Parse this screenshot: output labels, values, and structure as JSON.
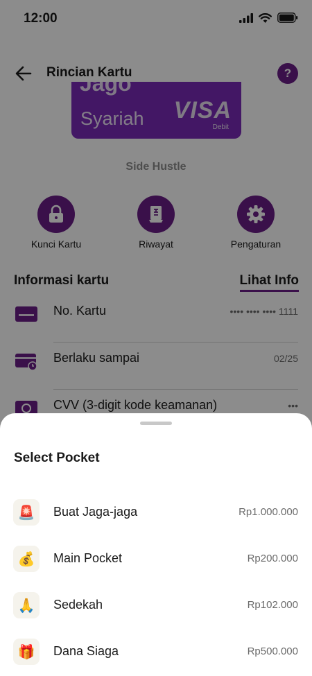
{
  "status_bar": {
    "time": "12:00"
  },
  "header": {
    "title": "Rincian Kartu",
    "help_label": "?"
  },
  "card": {
    "brand_top": "Jago",
    "brand": "Syariah",
    "network": "VISA",
    "network_sub": "Debit",
    "name": "Side Hustle"
  },
  "actions": [
    {
      "label": "Kunci Kartu",
      "icon": "lock-icon"
    },
    {
      "label": "Riwayat",
      "icon": "receipt-icon"
    },
    {
      "label": "Pengaturan",
      "icon": "gear-icon"
    }
  ],
  "info": {
    "title": "Informasi kartu",
    "link": "Lihat Info",
    "rows": [
      {
        "label": "No. Kartu",
        "value": "•••• •••• •••• 1111",
        "icon": "card-number-icon"
      },
      {
        "label": "Berlaku sampai",
        "value": "02/25",
        "icon": "card-expiry-icon"
      },
      {
        "label": "CVV (3-digit kode keamanan)",
        "value": "•••",
        "icon": "cvv-icon"
      }
    ]
  },
  "sheet": {
    "title": "Select Pocket",
    "pockets": [
      {
        "name": "Buat Jaga-jaga",
        "amount": "Rp1.000.000",
        "emoji": "🚨",
        "icon": "siren-icon"
      },
      {
        "name": "Main Pocket",
        "amount": "Rp200.000",
        "emoji": "💰",
        "icon": "money-bag-icon"
      },
      {
        "name": "Sedekah",
        "amount": "Rp102.000",
        "emoji": "🙏",
        "icon": "praying-hands-icon"
      },
      {
        "name": "Dana Siaga",
        "amount": "Rp500.000",
        "emoji": "🎁",
        "icon": "gift-money-icon"
      }
    ]
  },
  "colors": {
    "accent": "#6b1e87",
    "card": "#7a2bb8",
    "overlay": "rgba(0,0,0,0.45)"
  }
}
